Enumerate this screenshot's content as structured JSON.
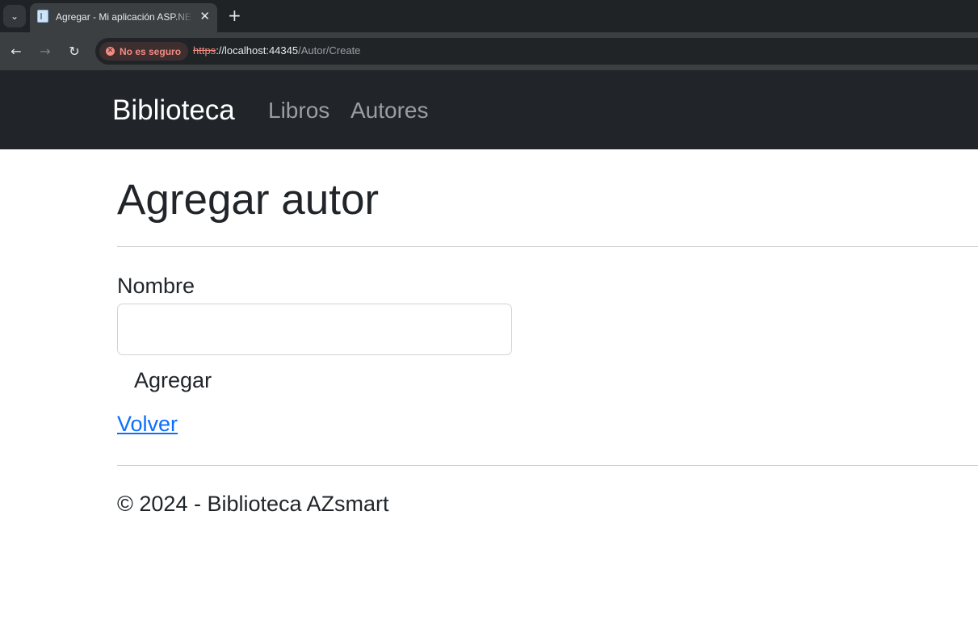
{
  "browser": {
    "tab_title": "Agregar - Mi aplicación ASP.NET",
    "security_chip": "No es seguro",
    "url_scheme": "https",
    "url_host": "://localhost:44345",
    "url_path": "/Autor/Create",
    "icons": {
      "tab_search": "chevron-down-icon",
      "tab_close": "close-icon",
      "new_tab": "plus-icon",
      "back": "arrow-left-icon",
      "forward": "arrow-right-icon",
      "reload": "reload-icon",
      "insecure": "warning-icon"
    },
    "colors": {
      "chrome": "#1f2326",
      "toolbar": "#3b3f42",
      "warning": "#f28b82"
    }
  },
  "navbar": {
    "brand": "Biblioteca",
    "links": [
      "Libros",
      "Autores"
    ],
    "colors": {
      "background": "#212529",
      "link": "#9a9da1"
    }
  },
  "main": {
    "title": "Agregar autor",
    "form": {
      "name_label": "Nombre",
      "name_value": "",
      "submit_label": "Agregar"
    },
    "back_link": "Volver",
    "link_color": "#0d6efd"
  },
  "footer": {
    "text": "© 2024 - Biblioteca AZsmart"
  }
}
